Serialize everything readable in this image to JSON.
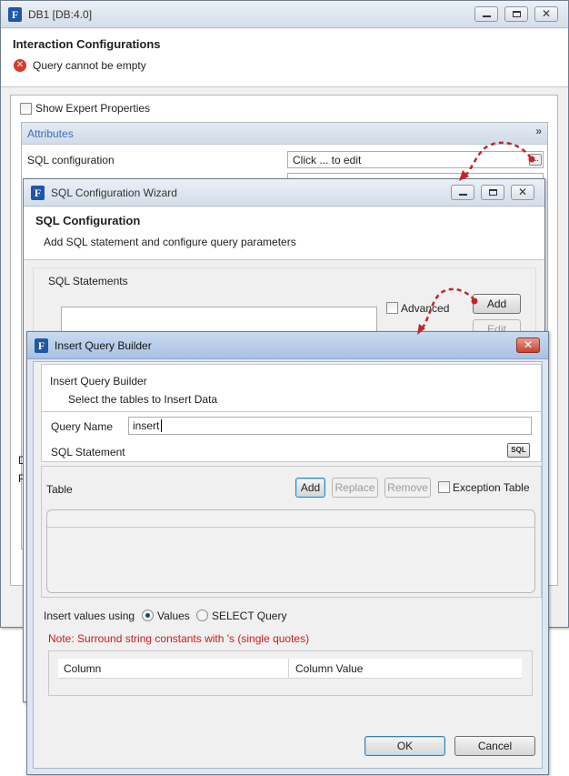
{
  "db_window": {
    "title": "DB1 [DB:4.0]",
    "heading": "Interaction Configurations",
    "error_text": "Query cannot be empty",
    "show_expert_label": "Show Expert Properties",
    "attributes_label": "Attributes",
    "sql_config_label": "SQL configuration",
    "sql_config_value": "Click ... to edit",
    "ellipsis_button_label": "...",
    "partial_labels": [
      "D",
      "P"
    ]
  },
  "wizard": {
    "title": "SQL Configuration Wizard",
    "heading": "SQL Configuration",
    "description": "Add SQL statement and configure query parameters",
    "statements_label": "SQL Statements",
    "advanced_label": "Advanced",
    "add_label": "Add",
    "edit_label": "Edit"
  },
  "query_builder": {
    "title": "Insert Query Builder",
    "heading": "Insert Query Builder",
    "subheading": "Select the tables to Insert Data",
    "query_name_label": "Query Name",
    "query_name_value": "insert",
    "sql_statement_label": "SQL Statement",
    "sql_button_label": "SQL",
    "table_label": "Table",
    "add_label": "Add",
    "replace_label": "Replace",
    "remove_label": "Remove",
    "exception_table_label": "Exception Table",
    "insert_values_label": "Insert values using",
    "values_option": "Values",
    "select_query_option": "SELECT Query",
    "note_text": "Note: Surround string constants with 's (single quotes)",
    "columns": [
      "Column",
      "Column Value"
    ],
    "ok_label": "OK",
    "cancel_label": "Cancel"
  },
  "colors": {
    "arrow": "#c0262a",
    "note": "#d0191e",
    "attributes_text": "#3a6fb5",
    "error_icon": "#d83a2c"
  }
}
